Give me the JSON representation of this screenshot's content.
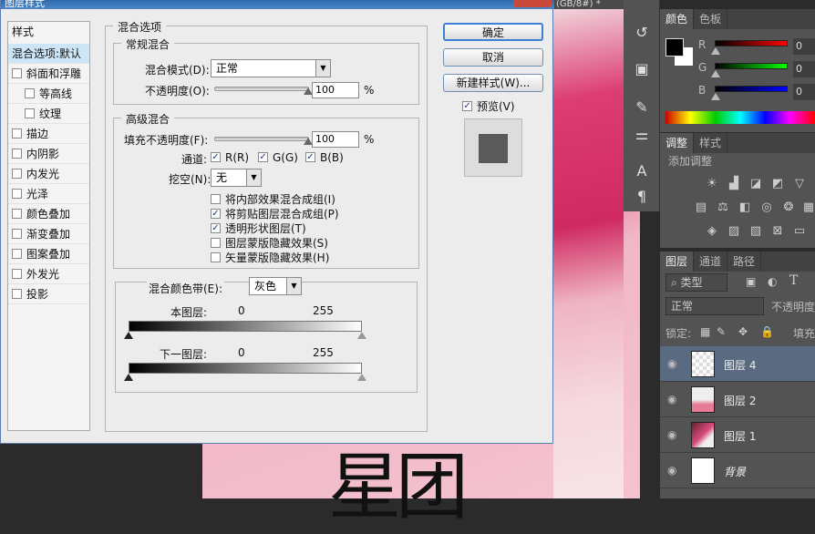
{
  "dialog": {
    "title": "图层样式",
    "style_list": {
      "header": "样式",
      "items": [
        {
          "label": "混合选项:默认",
          "checkbox": false,
          "selected": true,
          "indent": 0
        },
        {
          "label": "斜面和浮雕",
          "checkbox": true,
          "checked": false,
          "indent": 0
        },
        {
          "label": "等高线",
          "checkbox": true,
          "checked": false,
          "indent": 1
        },
        {
          "label": "纹理",
          "checkbox": true,
          "checked": false,
          "indent": 1
        },
        {
          "label": "描边",
          "checkbox": true,
          "checked": false,
          "indent": 0
        },
        {
          "label": "内阴影",
          "checkbox": true,
          "checked": false,
          "indent": 0
        },
        {
          "label": "内发光",
          "checkbox": true,
          "checked": false,
          "indent": 0
        },
        {
          "label": "光泽",
          "checkbox": true,
          "checked": false,
          "indent": 0
        },
        {
          "label": "颜色叠加",
          "checkbox": true,
          "checked": false,
          "indent": 0
        },
        {
          "label": "渐变叠加",
          "checkbox": true,
          "checked": false,
          "indent": 0
        },
        {
          "label": "图案叠加",
          "checkbox": true,
          "checked": false,
          "indent": 0
        },
        {
          "label": "外发光",
          "checkbox": true,
          "checked": false,
          "indent": 0
        },
        {
          "label": "投影",
          "checkbox": true,
          "checked": false,
          "indent": 0
        }
      ]
    },
    "blend_options": {
      "title": "混合选项",
      "general": {
        "title": "常规混合",
        "mode_label": "混合模式(D):",
        "mode_value": "正常",
        "opacity_label": "不透明度(O):",
        "opacity_value": "100",
        "opacity_percent": 100,
        "unit": "%"
      },
      "advanced": {
        "title": "高级混合",
        "fill_label": "填充不透明度(F):",
        "fill_value": "100",
        "fill_percent": 100,
        "unit": "%",
        "channels_label": "通道:",
        "channels": [
          {
            "label": "R(R)",
            "checked": true
          },
          {
            "label": "G(G)",
            "checked": true
          },
          {
            "label": "B(B)",
            "checked": true
          }
        ],
        "knockout_label": "挖空(N):",
        "knockout_value": "无",
        "options": [
          {
            "label": "将内部效果混合成组(I)",
            "checked": false
          },
          {
            "label": "将剪贴图层混合成组(P)",
            "checked": true
          },
          {
            "label": "透明形状图层(T)",
            "checked": true
          },
          {
            "label": "图层蒙版隐藏效果(S)",
            "checked": false
          },
          {
            "label": "矢量蒙版隐藏效果(H)",
            "checked": false
          }
        ]
      },
      "blend_if": {
        "label": "混合颜色带(E):",
        "value": "灰色",
        "this_layer": "本图层:",
        "this_min": "0",
        "this_max": "255",
        "underlying": "下一图层:",
        "under_min": "0",
        "under_max": "255"
      }
    },
    "buttons": {
      "ok": "确定",
      "cancel": "取消",
      "new_style": "新建样式(W)...",
      "preview": "预览(V)",
      "preview_checked": true
    }
  },
  "document": {
    "tab": "(GB/8#) *"
  },
  "color_panel": {
    "tabs": [
      "颜色",
      "色板"
    ],
    "channels": [
      {
        "label": "R",
        "value": "0",
        "color": "#ff0000"
      },
      {
        "label": "G",
        "value": "0",
        "color": "#00ff00"
      },
      {
        "label": "B",
        "value": "0",
        "color": "#0000ff"
      }
    ]
  },
  "adjust_panel": {
    "tabs": [
      "调整",
      "样式"
    ],
    "title": "添加调整"
  },
  "layers_panel": {
    "tabs": [
      "图层",
      "通道",
      "路径"
    ],
    "filter": "类型",
    "blend": "正常",
    "opacity_label": "不透明度",
    "lock_label": "锁定:",
    "fill_label": "填充",
    "layers": [
      {
        "name": "图层 4",
        "selected": true
      },
      {
        "name": "图层 2",
        "selected": false
      },
      {
        "name": "图层 1",
        "selected": false
      },
      {
        "name": "背景",
        "selected": false
      }
    ]
  }
}
